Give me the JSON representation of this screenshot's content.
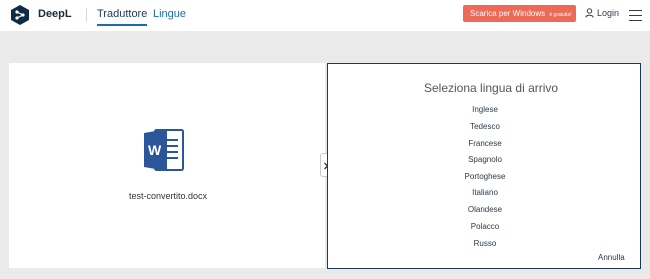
{
  "header": {
    "brand": "DeepL",
    "tabs": [
      {
        "label": "Traduttore",
        "active": true
      },
      {
        "label": "Lingue",
        "active": false
      }
    ],
    "download_button": {
      "label": "Scarica per Windows",
      "badge": "è gratuita!",
      "color": "#ec6a57"
    },
    "login_label": "Login",
    "icons": {
      "logo": "deepl-logo",
      "user": "user-icon",
      "menu": "hamburger-menu-icon"
    }
  },
  "source": {
    "filename": "test-convertito.docx",
    "file_icon": "word-document-icon"
  },
  "target_selector": {
    "title": "Seleziona lingua di arrivo",
    "languages": [
      "Inglese",
      "Tedesco",
      "Francese",
      "Spagnolo",
      "Portoghese",
      "Italiano",
      "Olandese",
      "Polacco",
      "Russo"
    ],
    "cancel_label": "Annulla"
  },
  "colors": {
    "accent": "#1b6fa8",
    "panel_border": "#1e3955",
    "word_blue": "#2b579a"
  }
}
